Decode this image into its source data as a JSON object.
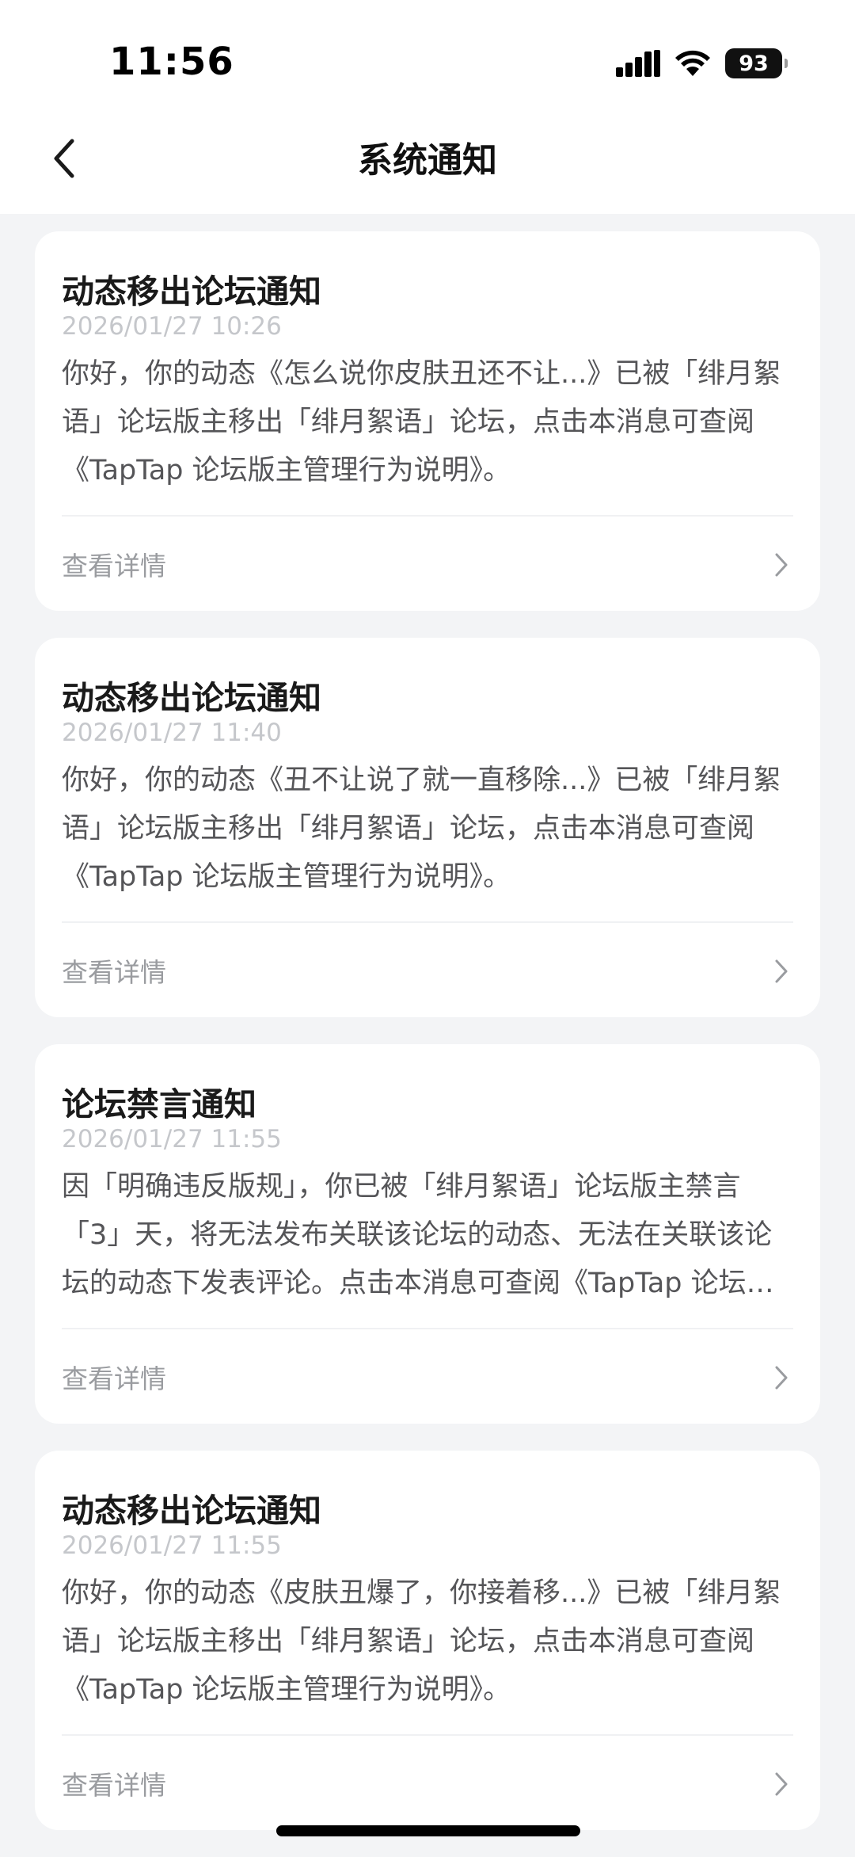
{
  "status_bar": {
    "time": "11:56",
    "battery": "93",
    "icons": [
      "signal-icon",
      "wifi-icon",
      "battery-icon"
    ]
  },
  "nav": {
    "title": "系统通知",
    "back_icon": "chevron-left-icon"
  },
  "notifications": [
    {
      "title": "动态移出论坛通知",
      "time": "2026/01/27 10:26",
      "body": "你好，你的动态《怎么说你皮肤丑还不让...》已被「绯月絮语」论坛版主移出「绯月絮语」论坛，点击本消息可查阅《TapTap 论坛版主管理行为说明》。",
      "action": "查看详情"
    },
    {
      "title": "动态移出论坛通知",
      "time": "2026/01/27 11:40",
      "body": "你好，你的动态《丑不让说了就一直移除...》已被「绯月絮语」论坛版主移出「绯月絮语」论坛，点击本消息可查阅《TapTap 论坛版主管理行为说明》。",
      "action": "查看详情"
    },
    {
      "title": "论坛禁言通知",
      "time": "2026/01/27 11:55",
      "body": "因「明确违反版规」，你已被「绯月絮语」论坛版主禁言「3」天，将无法发布关联该论坛的动态、无法在关联该论坛的动态下发表评论。点击本消息可查阅《TapTap 论坛版主管理行为说明》。",
      "action": "查看详情"
    },
    {
      "title": "动态移出论坛通知",
      "time": "2026/01/27 11:55",
      "body": "你好，你的动态《皮肤丑爆了，你接着移...》已被「绯月絮语」论坛版主移出「绯月絮语」论坛，点击本消息可查阅《TapTap 论坛版主管理行为说明》。",
      "action": "查看详情"
    }
  ],
  "colors": {
    "page_background": "#f3f4f6",
    "card_background": "#ffffff",
    "title_text": "#1a1a1a",
    "timestamp_text": "#c5c7cb",
    "body_text": "#555558",
    "secondary_text": "#9a9ca0"
  }
}
